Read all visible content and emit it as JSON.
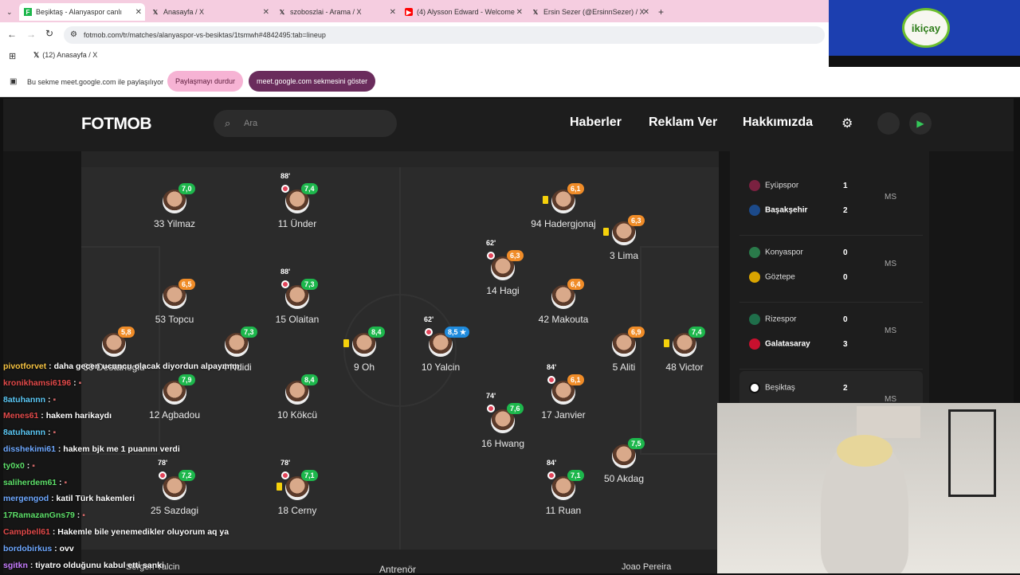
{
  "browser": {
    "tabs": [
      {
        "label": "Beşiktaş - Alanyaspor canlı",
        "active": true
      },
      {
        "label": "Anasayfa / X",
        "active": false
      },
      {
        "label": "szoboszlai - Arama / X",
        "active": false
      },
      {
        "label": "(4) Alysson Edward - Welcome",
        "active": false
      },
      {
        "label": "Ersin Sezer (@ErsinnSezer) / X",
        "active": false
      }
    ],
    "url": "fotmob.com/tr/matches/alanyaspor-vs-besiktas/1tsmwh#4842495:tab=lineup",
    "bookmark": "(12) Anasayfa / X",
    "share_text": "Bu sekme meet.google.com ile paylaşılıyor",
    "stop_share": "Paylaşmayı durdur",
    "show_tab": "meet.google.com sekmesini göster"
  },
  "overlay_logo": "ikiçay",
  "site": {
    "logo": "FOTMOB",
    "search_placeholder": "Ara",
    "nav": [
      "Haberler",
      "Reklam Ver",
      "Hakkımızda"
    ]
  },
  "lineup": [
    {
      "name": "33 Yilmaz",
      "rating": "7,0",
      "color": "#1db74c"
    },
    {
      "name": "11 Ünder",
      "rating": "7,4",
      "color": "#1db74c",
      "minute": "88'",
      "sub": true
    },
    {
      "name": "53 Topcu",
      "rating": "6,5",
      "color": "#f08c28"
    },
    {
      "name": "15 Olaitan",
      "rating": "7,3",
      "color": "#1db74c",
      "minute": "88'",
      "sub": true
    },
    {
      "name": "30 Destanoglu",
      "rating": "5,8",
      "color": "#f08c28"
    },
    {
      "name": "4 Ndidi",
      "rating": "7,3",
      "color": "#1db74c"
    },
    {
      "name": "9 Oh",
      "rating": "8,4",
      "color": "#1db74c",
      "yellow": true
    },
    {
      "name": "10 Yalcin",
      "rating": "8,5 ★",
      "color": "#1f8bdd",
      "minute": "62'",
      "sub": true
    },
    {
      "name": "12 Agbadou",
      "rating": "7,9",
      "color": "#1db74c"
    },
    {
      "name": "10 Kökcü",
      "rating": "8,4",
      "color": "#1db74c"
    },
    {
      "name": "25 Sazdagi",
      "rating": "7,2",
      "color": "#1db74c",
      "minute": "78'",
      "sub": true
    },
    {
      "name": "18 Cerny",
      "rating": "7,1",
      "color": "#1db74c",
      "minute": "78'",
      "sub": true,
      "yellow": true
    },
    {
      "name": "94 Hadergjonaj",
      "rating": "6,1",
      "color": "#f08c28",
      "yellow": true
    },
    {
      "name": "3 Lima",
      "rating": "6,3",
      "color": "#f08c28",
      "yellow": true
    },
    {
      "name": "14 Hagi",
      "rating": "6,3",
      "color": "#f08c28",
      "minute": "62'",
      "sub": true
    },
    {
      "name": "42 Makouta",
      "rating": "6,4",
      "color": "#f08c28"
    },
    {
      "name": "5 Aliti",
      "rating": "6,9",
      "color": "#f08c28"
    },
    {
      "name": "48 Victor",
      "rating": "7,4",
      "color": "#1db74c",
      "yellow": true
    },
    {
      "name": "17 Janvier",
      "rating": "6,1",
      "color": "#f08c28",
      "minute": "84'",
      "sub": true
    },
    {
      "name": "16 Hwang",
      "rating": "7,6",
      "color": "#1db74c",
      "minute": "74'",
      "sub": true
    },
    {
      "name": "50 Akdag",
      "rating": "7,5",
      "color": "#1db74c"
    },
    {
      "name": "11 Ruan",
      "rating": "7,1",
      "color": "#1db74c",
      "minute": "84'",
      "sub": true
    }
  ],
  "coaches": {
    "home": "Sergen Yalcin",
    "label": "Antrenör",
    "away": "Joao Pereira"
  },
  "matches": [
    {
      "home": "Eyüpspor",
      "hs": "1",
      "away": "Başakşehir",
      "as": "2",
      "status": "MS"
    },
    {
      "home": "Konyaspor",
      "hs": "0",
      "away": "Göztepe",
      "as": "0",
      "status": "MS"
    },
    {
      "home": "Rizespor",
      "hs": "0",
      "away": "Galatasaray",
      "as": "3",
      "status": "MS"
    },
    {
      "home": "Beşiktaş",
      "hs": "2",
      "away": "",
      "as": "",
      "status": "MS"
    }
  ],
  "chat": [
    {
      "user": "pivotforvet",
      "color": "#f6c342",
      "msg": "daha gecen ucuncu olacak diyordun alpayımm"
    },
    {
      "user": "kronikhamsi6196",
      "color": "#e24a4a",
      "msg": ""
    },
    {
      "user": "8atuhannn",
      "color": "#5bc8f5",
      "msg": ""
    },
    {
      "user": "Menes61",
      "color": "#e24a4a",
      "msg": "hakem harikaydı"
    },
    {
      "user": "8atuhannn",
      "color": "#5bc8f5",
      "msg": ""
    },
    {
      "user": "disshekimi61",
      "color": "#6ea8ff",
      "msg": "hakem bjk me 1 puanını verdi"
    },
    {
      "user": "ty0x0",
      "color": "#5ee06a",
      "msg": ""
    },
    {
      "user": "saliherdem61",
      "color": "#5ee06a",
      "msg": ""
    },
    {
      "user": "mergengod",
      "color": "#6ea8ff",
      "msg": "katil Türk hakemleri"
    },
    {
      "user": "17RamazanGns79",
      "color": "#5ee06a",
      "msg": ""
    },
    {
      "user": "Campbell61",
      "color": "#e24a4a",
      "msg": "Hakemle bile yenemedikler oluyorum aq ya"
    },
    {
      "user": "bordobirkus",
      "color": "#6ea8ff",
      "msg": "ovv"
    },
    {
      "user": "sgitkn",
      "color": "#c77dff",
      "msg": "tiyatro olduğunu kabul etti sanki"
    }
  ]
}
